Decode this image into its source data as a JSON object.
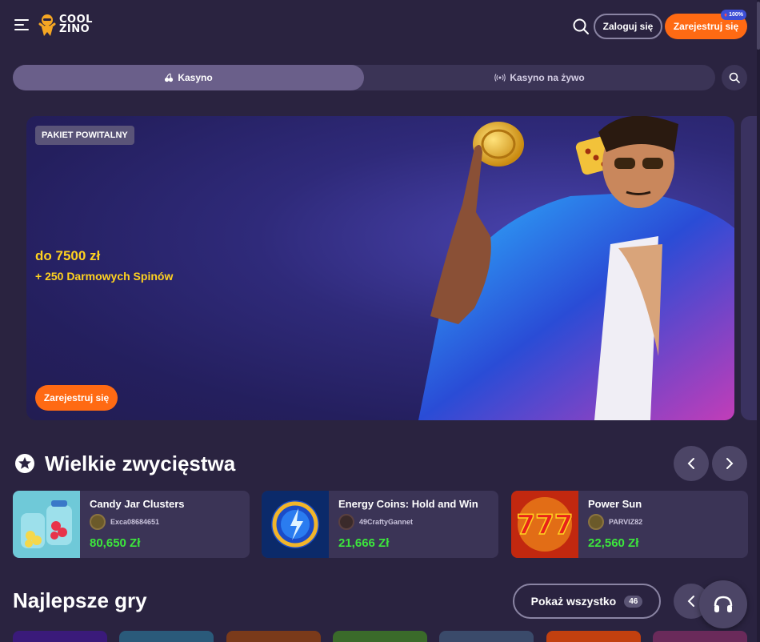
{
  "header": {
    "logo_line1": "COOL",
    "logo_line2": "ZINO",
    "login_label": "Zaloguj się",
    "register_label": "Zarejestruj się",
    "register_badge": "100%"
  },
  "tabs": [
    {
      "label": "Kasyno",
      "icon": "cherry-icon",
      "active": true
    },
    {
      "label": "Kasyno na żywo",
      "icon": "broadcast-icon",
      "active": false
    }
  ],
  "banner": {
    "badge": "PAKIET POWITALNY",
    "amount": "do 7500 zł",
    "spins": "+ 250 Darmowych Spinów",
    "cta": "Zarejestruj się"
  },
  "big_wins": {
    "title": "Wielkie zwycięstwa",
    "items": [
      {
        "game": "Candy Jar Clusters",
        "user": "Exca08684651",
        "amount": "80,650 Zł"
      },
      {
        "game": "Energy Coins: Hold and Win",
        "user": "49CraftyGannet",
        "amount": "21,666 Zł"
      },
      {
        "game": "Power Sun",
        "user": "PARVIZ82",
        "amount": "22,560 Zł"
      }
    ]
  },
  "top_games": {
    "title": "Najlepsze gry",
    "show_all_label": "Pokaż wszystko",
    "count": "46"
  },
  "colors": {
    "background": "#2a2340",
    "accent": "#ff6a13",
    "promo_text": "#ffd21f",
    "win_amount": "#3ce63c"
  }
}
